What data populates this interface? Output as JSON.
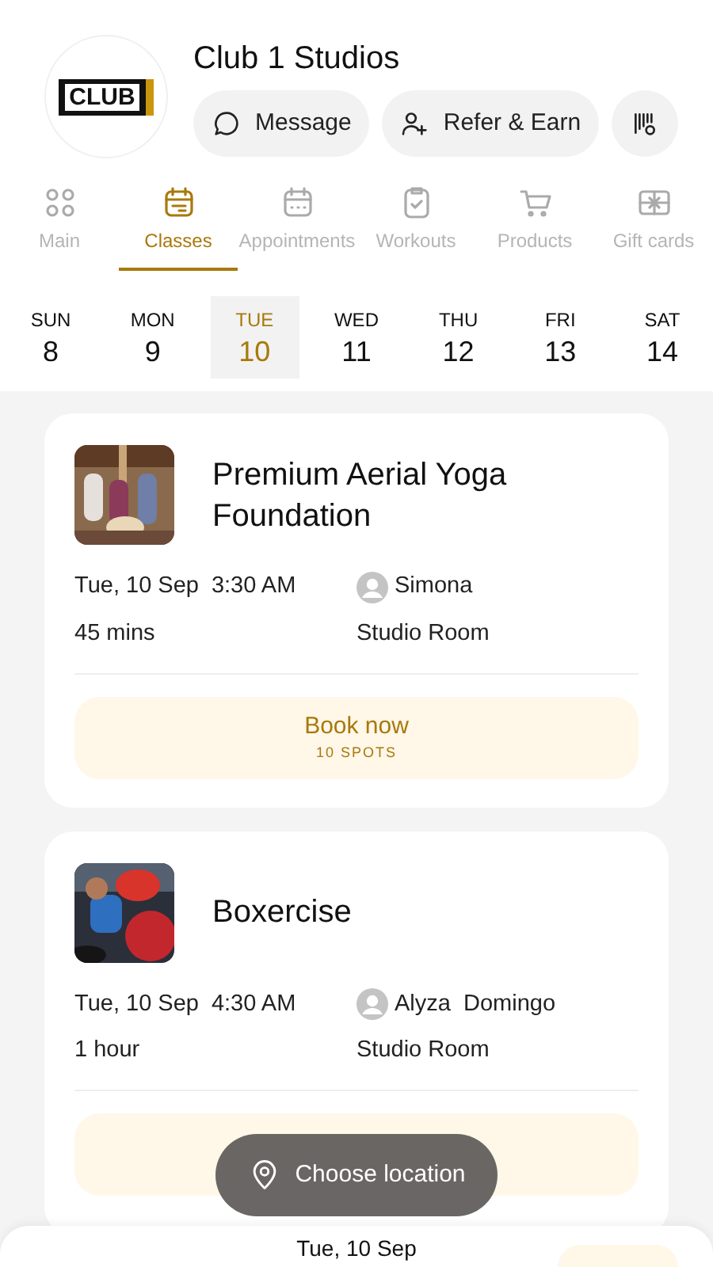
{
  "studio": {
    "name": "Club 1 Studios",
    "logo_text": "CLUB"
  },
  "actions": [
    {
      "kind": "message",
      "label": "Message"
    },
    {
      "kind": "refer",
      "label": "Refer & Earn"
    },
    {
      "kind": "scan"
    }
  ],
  "tabs": [
    {
      "kind": "grid",
      "label": "Main",
      "selected": false
    },
    {
      "kind": "calendar",
      "label": "Classes",
      "selected": true
    },
    {
      "kind": "calendar-dots",
      "label": "Appointments",
      "selected": false
    },
    {
      "kind": "clipboard",
      "label": "Workouts",
      "selected": false
    },
    {
      "kind": "cart",
      "label": "Products",
      "selected": false
    },
    {
      "kind": "gift",
      "label": "Gift cards",
      "selected": false
    }
  ],
  "days": [
    {
      "weekday": "SUN",
      "date": "8",
      "selected": false
    },
    {
      "weekday": "MON",
      "date": "9",
      "selected": false
    },
    {
      "weekday": "TUE",
      "date": "10",
      "selected": true
    },
    {
      "weekday": "WED",
      "date": "11",
      "selected": false
    },
    {
      "weekday": "THU",
      "date": "12",
      "selected": false
    },
    {
      "weekday": "FRI",
      "date": "13",
      "selected": false
    },
    {
      "weekday": "SAT",
      "date": "14",
      "selected": false
    }
  ],
  "classes": [
    {
      "title": "Premium Aerial Yoga Foundation",
      "date": "Tue, 10 Sep",
      "time": "3:30 AM",
      "duration": "45 mins",
      "instructor": "Simona",
      "room": "Studio Room",
      "button": "Book now",
      "spots": "10 SPOTS"
    },
    {
      "title": "Boxercise",
      "date": "Tue, 10 Sep",
      "time": "4:30 AM",
      "duration": "1 hour",
      "instructor": "Alyza  Domingo",
      "room": "Studio Room"
    }
  ],
  "location_chip": "Choose location",
  "bottom_sheet": {
    "date": "Tue, 10 Sep"
  }
}
